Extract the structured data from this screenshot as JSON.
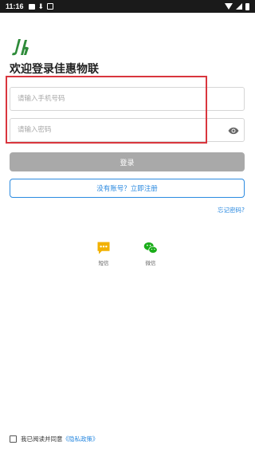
{
  "status_bar": {
    "time": "11:16",
    "icons": [
      "image-icon",
      "download-icon",
      "notification-icon",
      "wifi-icon",
      "signal-icon",
      "battery-icon"
    ]
  },
  "logo": {
    "icon": "jiahui-logo-icon",
    "color": "#2e8b3a"
  },
  "title": "欢迎登录佳惠物联",
  "phone_input": {
    "placeholder": "请输入手机号码",
    "value": ""
  },
  "password_input": {
    "placeholder": "请输入密码",
    "value": "",
    "icon": "eye-icon"
  },
  "login_button": {
    "label": "登录"
  },
  "register_button": {
    "label": "没有账号？立即注册"
  },
  "forgot_link": {
    "label": "忘记密码?"
  },
  "alt_logins": [
    {
      "label": "短信",
      "icon": "sms-icon",
      "color": "#f2b100"
    },
    {
      "label": "微信",
      "icon": "wechat-icon",
      "color": "#1aad19"
    }
  ],
  "agreement": {
    "text": "我已阅读并同意",
    "link": "《隐私政策》",
    "checked": false
  },
  "colors": {
    "accent": "#2b8ae0",
    "highlight": "#d9363e",
    "login_disabled": "#a9a9a9"
  }
}
